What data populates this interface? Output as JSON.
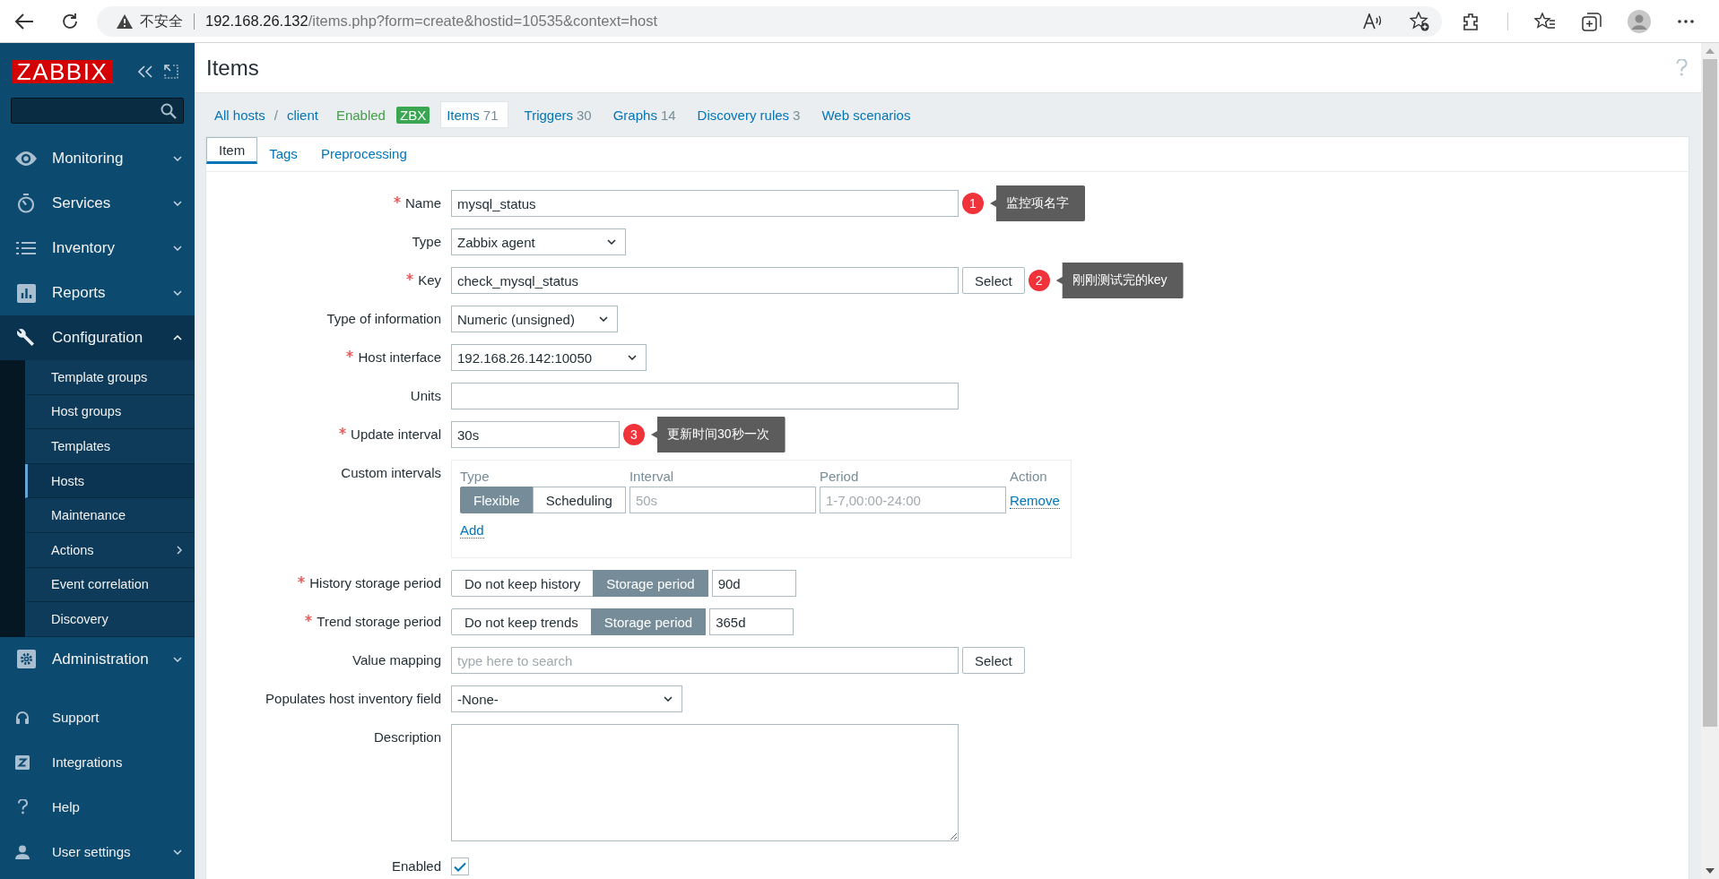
{
  "browser": {
    "security_label": "不安全",
    "url_host": "192.168.26.132",
    "url_path": "/items.php?form=create&hostid=10535&context=host"
  },
  "sidebar": {
    "logo": "ZABBIX",
    "menu": [
      {
        "label": "Monitoring",
        "expanded": false
      },
      {
        "label": "Services",
        "expanded": false
      },
      {
        "label": "Inventory",
        "expanded": false
      },
      {
        "label": "Reports",
        "expanded": false
      },
      {
        "label": "Configuration",
        "expanded": true,
        "children": [
          {
            "label": "Template groups",
            "selected": false,
            "has_submenu": false
          },
          {
            "label": "Host groups",
            "selected": false,
            "has_submenu": false
          },
          {
            "label": "Templates",
            "selected": false,
            "has_submenu": false
          },
          {
            "label": "Hosts",
            "selected": true,
            "has_submenu": false
          },
          {
            "label": "Maintenance",
            "selected": false,
            "has_submenu": false
          },
          {
            "label": "Actions",
            "selected": false,
            "has_submenu": true
          },
          {
            "label": "Event correlation",
            "selected": false,
            "has_submenu": false
          },
          {
            "label": "Discovery",
            "selected": false,
            "has_submenu": false
          }
        ]
      },
      {
        "label": "Administration",
        "expanded": false
      }
    ],
    "footer": [
      {
        "label": "Support",
        "has_dropdown": false
      },
      {
        "label": "Integrations",
        "has_dropdown": false
      },
      {
        "label": "Help",
        "has_dropdown": false
      },
      {
        "label": "User settings",
        "has_dropdown": true
      }
    ]
  },
  "page": {
    "title": "Items"
  },
  "host_nav": {
    "breadcrumb": [
      "All hosts",
      "client"
    ],
    "separator": "/",
    "status": "Enabled",
    "availability": "ZBX",
    "tabs": [
      {
        "label": "Items",
        "count": "71",
        "selected": true
      },
      {
        "label": "Triggers",
        "count": "30",
        "selected": false
      },
      {
        "label": "Graphs",
        "count": "14",
        "selected": false
      },
      {
        "label": "Discovery rules",
        "count": "3",
        "selected": false
      },
      {
        "label": "Web scenarios",
        "selected": false
      }
    ]
  },
  "form_tabs": [
    {
      "label": "Item",
      "selected": true
    },
    {
      "label": "Tags",
      "selected": false
    },
    {
      "label": "Preprocessing",
      "selected": false
    }
  ],
  "fields": [
    {
      "kind": "text",
      "label": "Name",
      "required": true,
      "value": "mysql_status",
      "annotation": {
        "number": "1",
        "text": "监控项名字"
      }
    },
    {
      "kind": "select",
      "label": "Type",
      "required": false,
      "value": "Zabbix agent"
    },
    {
      "kind": "text_button",
      "label": "Key",
      "required": true,
      "value": "check_mysql_status",
      "button": "Select",
      "annotation": {
        "number": "2",
        "text": "刚刚测试完的key"
      }
    },
    {
      "kind": "select",
      "label": "Type of information",
      "required": false,
      "value": "Numeric (unsigned)"
    },
    {
      "kind": "select",
      "label": "Host interface",
      "required": true,
      "value": "192.168.26.142:10050"
    },
    {
      "kind": "text",
      "label": "Units",
      "required": false
    },
    {
      "kind": "text",
      "label": "Update interval",
      "required": true,
      "value": "30s",
      "annotation": {
        "number": "3",
        "text": "更新时间30秒一次"
      }
    },
    {
      "kind": "intervals",
      "label": "Custom intervals",
      "required": false,
      "columns": [
        "Type",
        "Interval",
        "Period",
        "Action"
      ],
      "rows": [
        {
          "options": [
            {
              "label": "Flexible",
              "selected": true
            },
            {
              "label": "Scheduling",
              "selected": false
            }
          ],
          "interval_placeholder": "50s",
          "period_placeholder": "1-7,00:00-24:00",
          "action": "Remove"
        }
      ],
      "add": "Add"
    },
    {
      "kind": "segmented",
      "label": "History storage period",
      "required": true,
      "options": [
        {
          "label": "Do not keep history",
          "selected": false
        },
        {
          "label": "Storage period",
          "selected": true
        }
      ],
      "value": "90d"
    },
    {
      "kind": "segmented",
      "label": "Trend storage period",
      "required": true,
      "options": [
        {
          "label": "Do not keep trends",
          "selected": false
        },
        {
          "label": "Storage period",
          "selected": true
        }
      ],
      "value": "365d"
    },
    {
      "kind": "text_button",
      "label": "Value mapping",
      "required": false,
      "placeholder": "type here to search",
      "button": "Select"
    },
    {
      "kind": "select",
      "label": "Populates host inventory field",
      "required": false,
      "value": "-None-"
    },
    {
      "kind": "textarea",
      "label": "Description",
      "required": false
    },
    {
      "kind": "checkbox",
      "label": "Enabled",
      "required": false,
      "checked": true
    }
  ]
}
